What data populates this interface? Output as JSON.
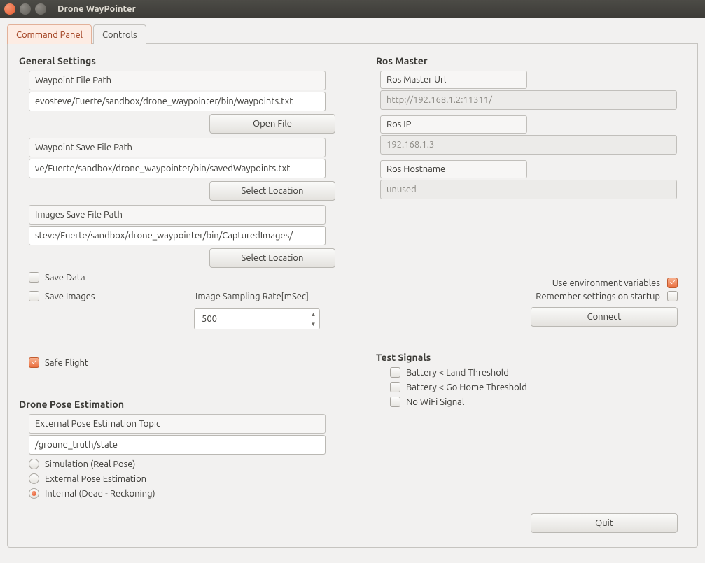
{
  "window": {
    "title": "Drone WayPointer"
  },
  "tabs": {
    "command_panel": "Command Panel",
    "controls": "Controls"
  },
  "general": {
    "title": "General Settings",
    "waypoint_file_label": "Waypoint File Path",
    "waypoint_file_value": "evosteve/Fuerte/sandbox/drone_waypointer/bin/waypoints.txt",
    "open_file": "Open File",
    "waypoint_save_label": "Waypoint Save File Path",
    "waypoint_save_value": "ve/Fuerte/sandbox/drone_waypointer/bin/savedWaypoints.txt",
    "select_location": "Select Location",
    "images_save_label": "Images Save File Path",
    "images_save_value": "steve/Fuerte/sandbox/drone_waypointer/bin/CapturedImages/",
    "save_data": "Save Data",
    "save_images": "Save Images",
    "sampling_label": "Image Sampling Rate[mSec]",
    "sampling_value": "500",
    "safe_flight": "Safe Flight"
  },
  "pose": {
    "title": "Drone Pose Estimation",
    "topic_label": "External Pose Estimation Topic",
    "topic_value": "/ground_truth/state",
    "opt_sim": "Simulation (Real Pose)",
    "opt_ext": "External Pose Estimation",
    "opt_int": "Internal (Dead - Reckoning)"
  },
  "ros": {
    "title": "Ros Master",
    "url_label": "Ros Master Url",
    "url_value": "http://192.168.1.2:11311/",
    "ip_label": "Ros IP",
    "ip_value": "192.168.1.3",
    "host_label": "Ros Hostname",
    "host_value": "unused",
    "use_env": "Use environment variables",
    "remember": "Remember settings on startup",
    "connect": "Connect"
  },
  "test": {
    "title": "Test Signals",
    "batt_land": "Battery < Land Threshold",
    "batt_home": "Battery < Go Home Threshold",
    "no_wifi": "No WiFi Signal"
  },
  "quit": "Quit"
}
